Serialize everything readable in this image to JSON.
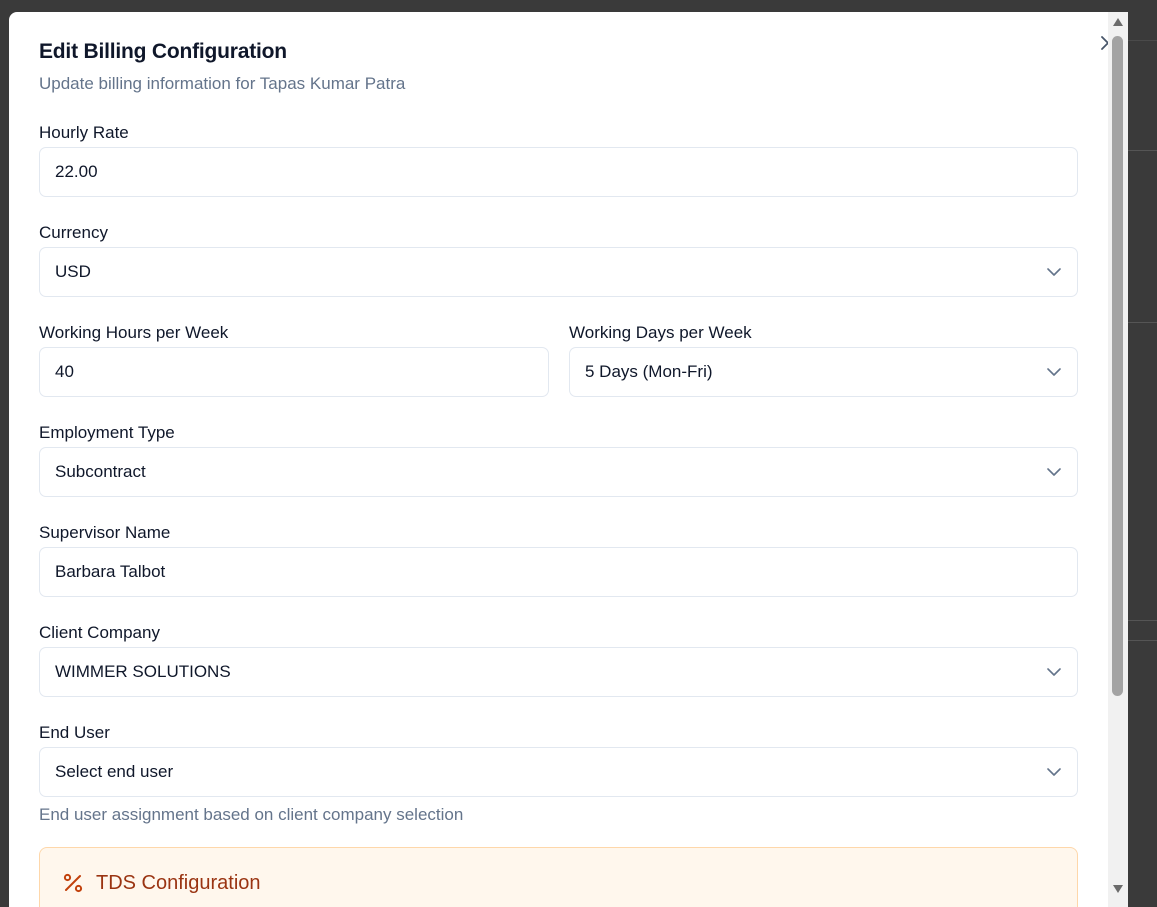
{
  "dialog": {
    "title": "Edit Billing Configuration",
    "subtitle": "Update billing information for Tapas Kumar Patra"
  },
  "form": {
    "hourly_rate": {
      "label": "Hourly Rate",
      "value": "22.00"
    },
    "currency": {
      "label": "Currency",
      "value": "USD"
    },
    "working_hours": {
      "label": "Working Hours per Week",
      "value": "40"
    },
    "working_days": {
      "label": "Working Days per Week",
      "value": "5 Days (Mon-Fri)"
    },
    "employment_type": {
      "label": "Employment Type",
      "value": "Subcontract"
    },
    "supervisor_name": {
      "label": "Supervisor Name",
      "value": "Barbara Talbot"
    },
    "client_company": {
      "label": "Client Company",
      "value": "WIMMER SOLUTIONS"
    },
    "end_user": {
      "label": "End User",
      "placeholder": "Select end user",
      "helper": "End user assignment based on client company selection"
    }
  },
  "tds": {
    "title": "TDS Configuration",
    "icon": "percent-icon"
  },
  "icons": {
    "close": "close-icon",
    "dropdown": "chevron-down-icon"
  },
  "colors": {
    "accent_orange": "#c2410c",
    "tds_bg": "#fff7ed",
    "border": "#e2e8f0",
    "muted_text": "#64748b"
  }
}
